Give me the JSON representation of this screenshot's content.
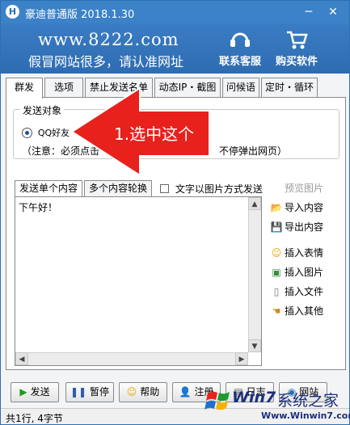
{
  "window": {
    "title": "豪迪普通版 2018.1.30",
    "app_icon": "H"
  },
  "banner": {
    "site_url": "www.8222.com",
    "slogan": "假冒网站很多，请认准网址",
    "service_label": "联系客服",
    "buy_label": "购买软件"
  },
  "tabs": [
    "群发",
    "选项",
    "禁止发送名单",
    "动态IP・截图",
    "问候语",
    "定时・循环"
  ],
  "send_target": {
    "group_title": "发送对象",
    "radio_label": "QQ好友",
    "note_start": "（注意：必须点击",
    "note_end": "不停弹出网页）"
  },
  "content": {
    "tab_single": "发送单个内容",
    "tab_rotate": "多个内容轮换",
    "image_mode_label": "文字以图片方式发送",
    "text": "下午好！"
  },
  "side": {
    "preview": "预览图片",
    "import": "导入内容",
    "export": "导出内容",
    "insert_emoji": "插入表情",
    "insert_image": "插入图片",
    "insert_file": "插入文件",
    "insert_other": "插入其他"
  },
  "buttons": {
    "send": "发送",
    "pause": "暂停",
    "help": "帮助",
    "register": "注册",
    "log": "日志",
    "website": "网站"
  },
  "status": {
    "text": "共1行, 4字节"
  },
  "annotation": {
    "label": "1.选中这个"
  },
  "watermark": {
    "brand": "Win7",
    "cn": "系统之家",
    "url": "Www.Winwin7.com"
  },
  "colors": {
    "titlebar": "#3b82c8",
    "annotation": "#e8211c"
  }
}
